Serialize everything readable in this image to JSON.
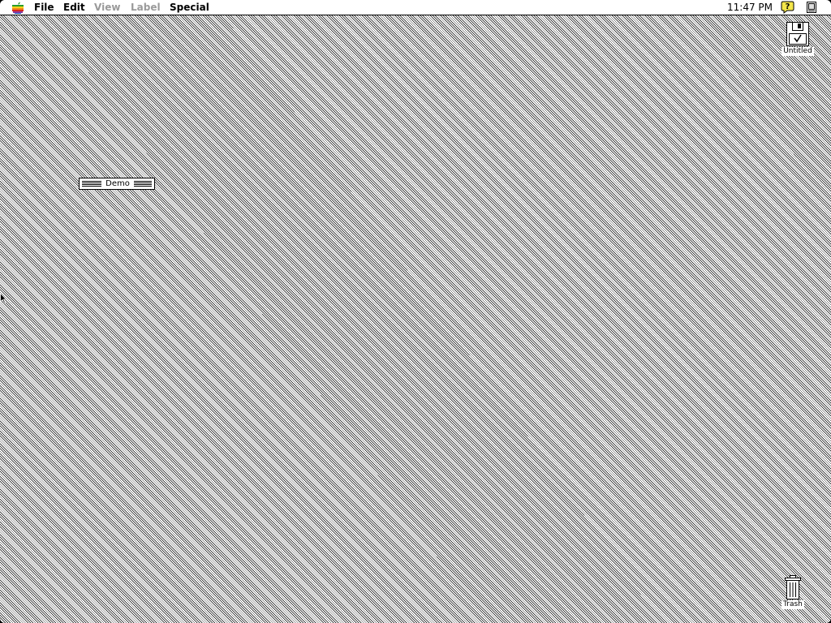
{
  "menubar": {
    "apple_icon": "apple-icon",
    "menus": [
      {
        "label": "File",
        "enabled": true
      },
      {
        "label": "Edit",
        "enabled": true
      },
      {
        "label": "View",
        "enabled": false
      },
      {
        "label": "Label",
        "enabled": false
      },
      {
        "label": "Special",
        "enabled": true
      }
    ],
    "clock": "11:47 PM",
    "help_icon": "help-icon",
    "app_menu_icon": "finder-app-icon"
  },
  "desktop": {
    "disk": {
      "label": "Untitled",
      "icon": "floppy-disk-icon"
    },
    "trash": {
      "label": "Trash",
      "icon": "trash-can-icon"
    },
    "collapsed_window": {
      "title": "Demo"
    }
  },
  "colors": {
    "menu_text": "#000000",
    "disabled_menu_text": "#9a9a9a",
    "desktop_pattern": "#000000"
  }
}
